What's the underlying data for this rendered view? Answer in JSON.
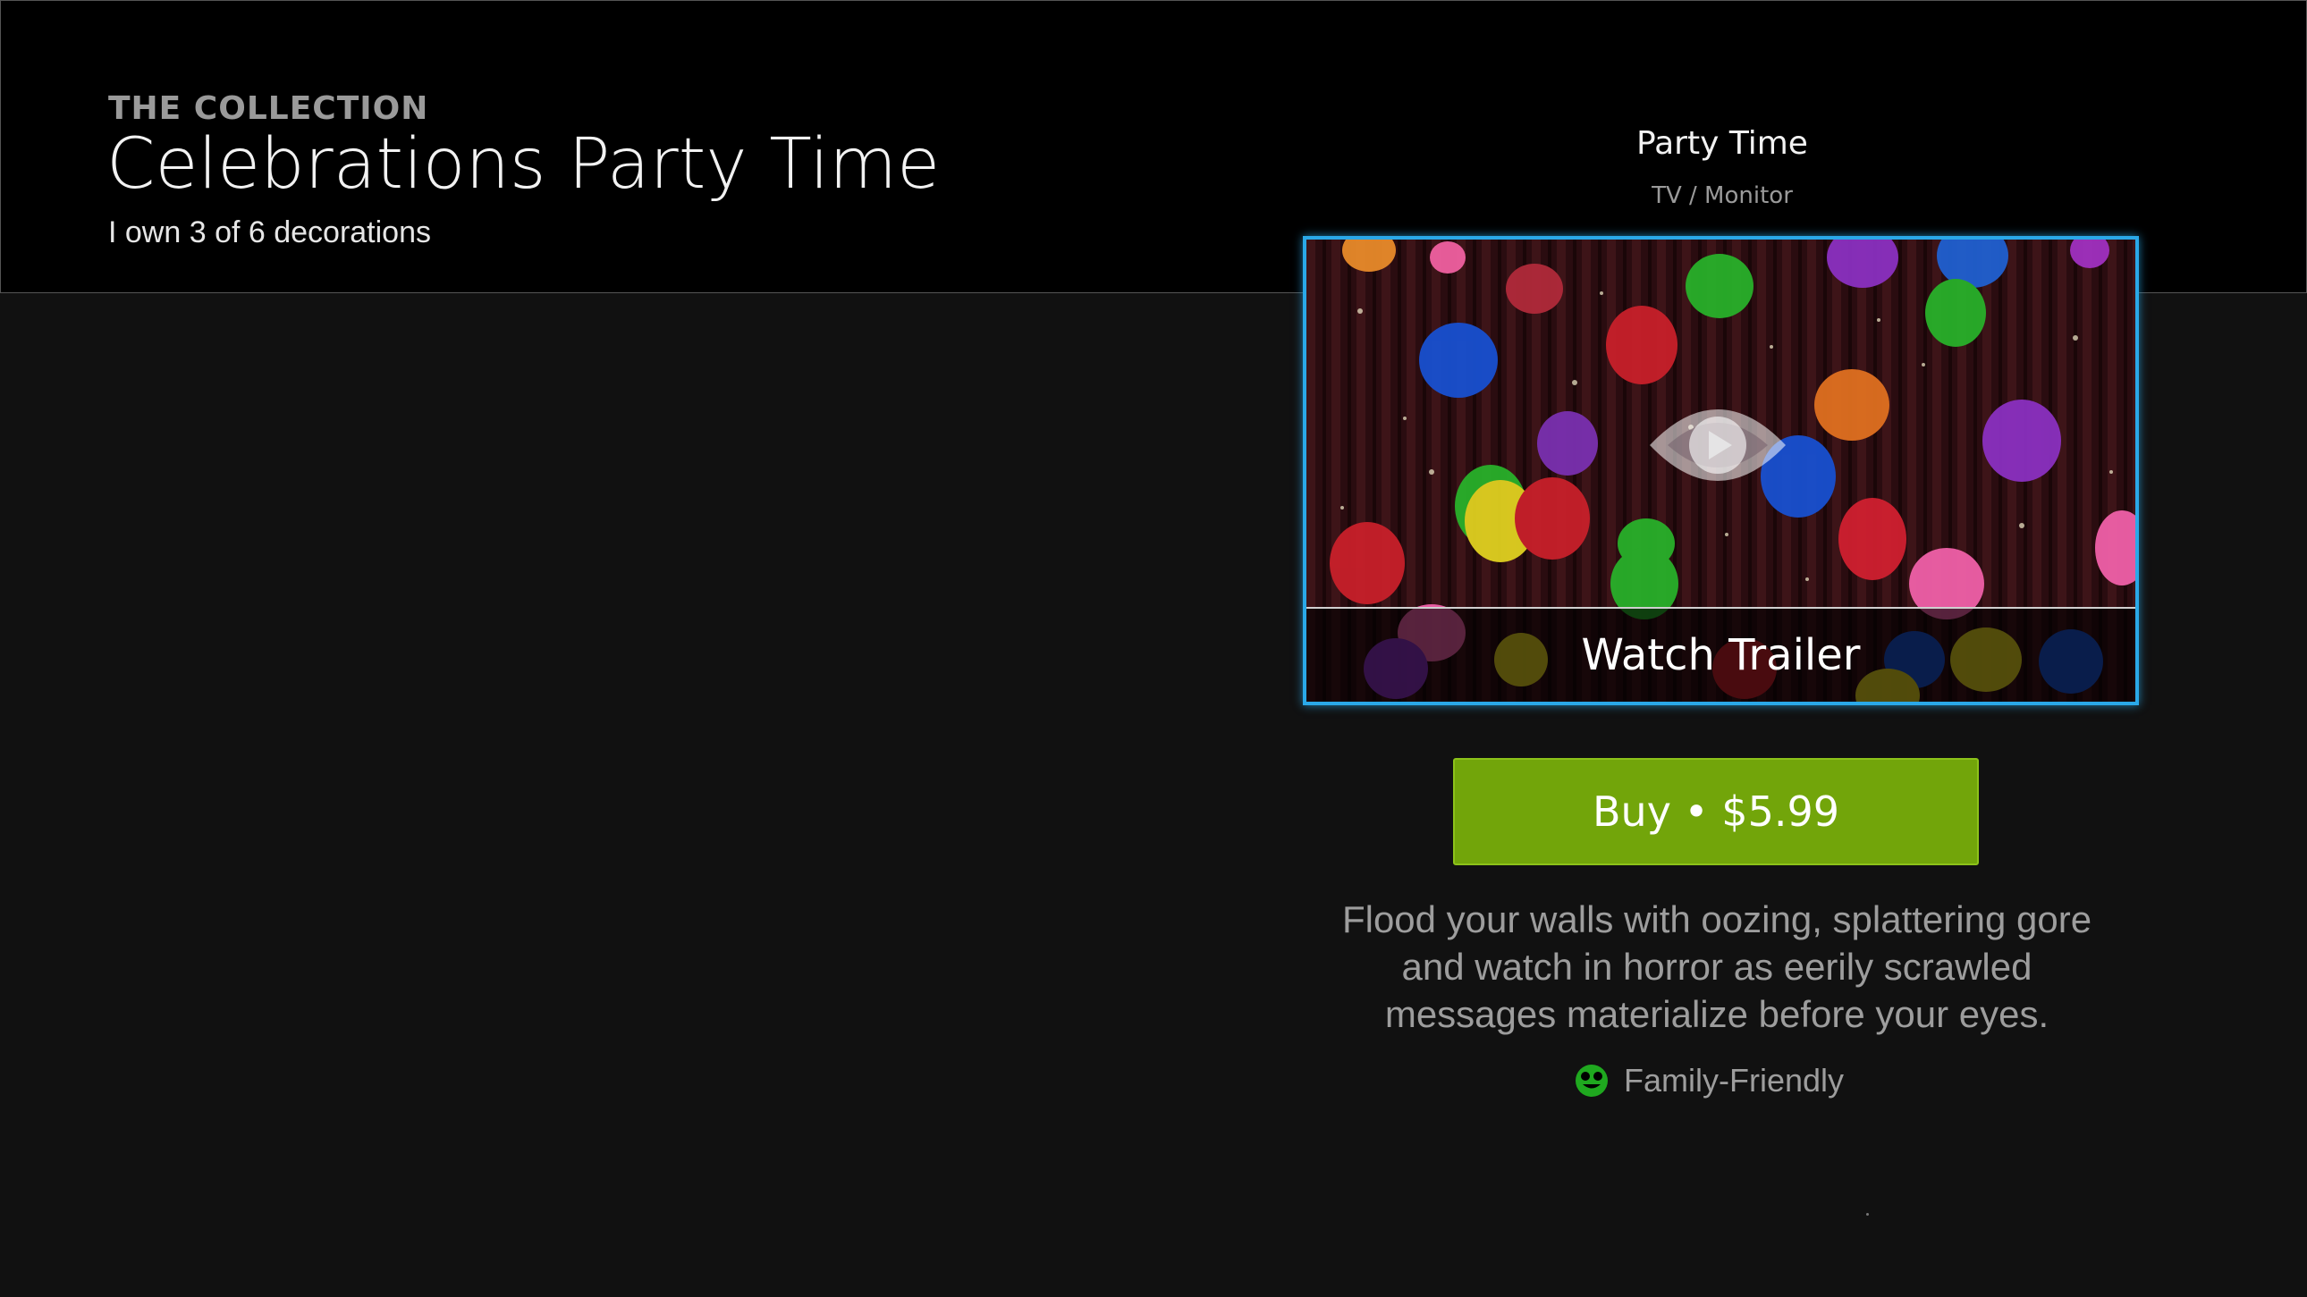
{
  "header": {
    "eyebrow": "THE COLLECTION",
    "title": "Celebrations Party Time",
    "ownership": "I own 3 of 6 decorations"
  },
  "item": {
    "title": "Party Time",
    "subtitle": "TV / Monitor",
    "trailer_label": "Watch Trailer",
    "buy_label": "Buy • $5.99",
    "description": "Flood your walls with oozing, splattering gore and watch in horror as eerily scrawled messages materialize before your eyes.",
    "rating_icon": "smiley-face-icon",
    "rating_label": "Family-Friendly"
  },
  "colors": {
    "background": "#111111",
    "header_background": "#000000",
    "focus_border": "#2aa8e8",
    "buy_button": "#72a50a",
    "rating_icon": "#1fa81f"
  }
}
